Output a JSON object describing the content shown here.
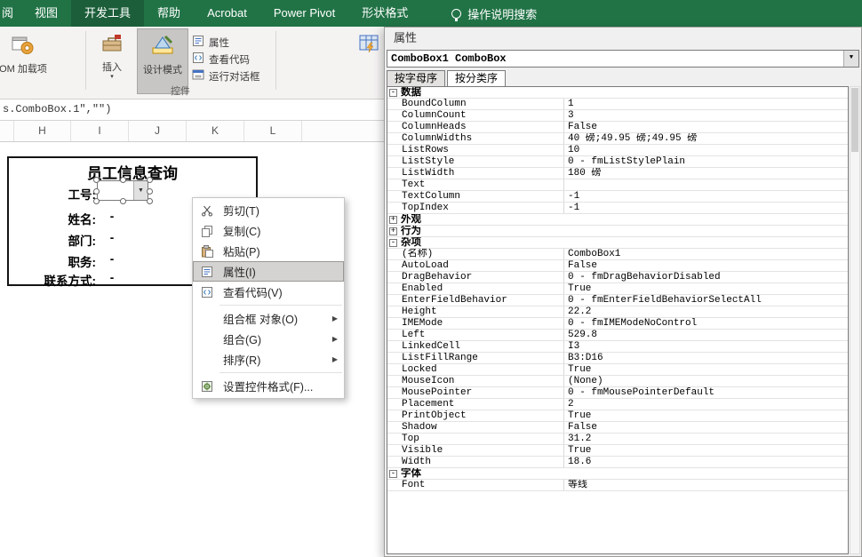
{
  "ribbon": {
    "tabs": [
      {
        "label": "阅",
        "active": false,
        "partial": true
      },
      {
        "label": "视图",
        "active": false
      },
      {
        "label": "开发工具",
        "active": true
      },
      {
        "label": "帮助",
        "active": false
      },
      {
        "label": "Acrobat",
        "active": false
      },
      {
        "label": "Power Pivot",
        "active": false
      },
      {
        "label": "形状格式",
        "active": false
      }
    ],
    "search": {
      "icon": "lightbulb-icon",
      "label": "操作说明搜索"
    },
    "buttons": {
      "com_addins": {
        "label": "OM 加载项",
        "icon": "com-addins-icon"
      },
      "insert": {
        "label": "插入",
        "icon": "toolbox-icon"
      },
      "design_mode": {
        "label": "设计模式",
        "icon": "design-mode-icon",
        "pressed": true
      },
      "properties": {
        "label": "属性",
        "icon": "properties-icon"
      },
      "view_code": {
        "label": "查看代码",
        "icon": "view-code-icon"
      },
      "run_dialog": {
        "label": "运行对话框",
        "icon": "run-dialog-icon"
      },
      "source": {
        "label": "",
        "icon": "source-icon"
      }
    },
    "groups": {
      "controls_label": "控件"
    }
  },
  "formula_bar": {
    "text": "s.ComboBox.1\",\"\")"
  },
  "sheet": {
    "column_headers": [
      "H",
      "I",
      "J",
      "K",
      "L"
    ],
    "form": {
      "title": "员工信息查询",
      "rows": [
        {
          "label": "工号:",
          "value": ""
        },
        {
          "label": "姓名:",
          "value": "-"
        },
        {
          "label": "部门:",
          "value": "-"
        },
        {
          "label": "职务:",
          "value": "-"
        },
        {
          "label": "联系方式:",
          "value": "-"
        }
      ]
    },
    "combobox": {
      "name": "ComboBox1",
      "selected": true
    }
  },
  "context_menu": {
    "items": [
      {
        "label": "剪切(T)",
        "icon": "scissors-icon"
      },
      {
        "label": "复制(C)",
        "icon": "copy-icon"
      },
      {
        "label": "粘贴(P)",
        "icon": "paste-icon"
      },
      {
        "label": "属性(I)",
        "icon": "properties-icon",
        "highlighted": true
      },
      {
        "label": "查看代码(V)",
        "icon": "view-code-icon"
      },
      {
        "separator": true
      },
      {
        "label": "组合框 对象(O)",
        "submenu": true
      },
      {
        "label": "组合(G)",
        "submenu": true
      },
      {
        "label": "排序(R)",
        "submenu": true
      },
      {
        "separator": true
      },
      {
        "label": "设置控件格式(F)...",
        "icon": "format-control-icon"
      }
    ]
  },
  "properties_panel": {
    "title": "属性",
    "object_selector": "ComboBox1 ComboBox",
    "tabs": [
      {
        "label": "按字母序",
        "active": false
      },
      {
        "label": "按分类序",
        "active": true
      }
    ],
    "rows": [
      {
        "type": "category",
        "label": "数据",
        "expanded": true
      },
      {
        "name": "BoundColumn",
        "value": "1"
      },
      {
        "name": "ColumnCount",
        "value": "3"
      },
      {
        "name": "ColumnHeads",
        "value": "False"
      },
      {
        "name": "ColumnWidths",
        "value": "40 磅;49.95 磅;49.95 磅"
      },
      {
        "name": "ListRows",
        "value": "10"
      },
      {
        "name": "ListStyle",
        "value": "0 - fmListStylePlain"
      },
      {
        "name": "ListWidth",
        "value": "180 磅"
      },
      {
        "name": "Text",
        "value": ""
      },
      {
        "name": "TextColumn",
        "value": "-1"
      },
      {
        "name": "TopIndex",
        "value": "-1"
      },
      {
        "type": "category",
        "label": "外观",
        "expanded": false
      },
      {
        "type": "category",
        "label": "行为",
        "expanded": false
      },
      {
        "type": "category",
        "label": "杂项",
        "expanded": true
      },
      {
        "name": "(名称)",
        "value": "ComboBox1"
      },
      {
        "name": "AutoLoad",
        "value": "False"
      },
      {
        "name": "DragBehavior",
        "value": "0 - fmDragBehaviorDisabled"
      },
      {
        "name": "Enabled",
        "value": "True"
      },
      {
        "name": "EnterFieldBehavior",
        "value": "0 - fmEnterFieldBehaviorSelectAll"
      },
      {
        "name": "Height",
        "value": "22.2"
      },
      {
        "name": "IMEMode",
        "value": "0 - fmIMEModeNoControl"
      },
      {
        "name": "Left",
        "value": "529.8"
      },
      {
        "name": "LinkedCell",
        "value": "I3"
      },
      {
        "name": "ListFillRange",
        "value": "B3:D16"
      },
      {
        "name": "Locked",
        "value": "True"
      },
      {
        "name": "MouseIcon",
        "value": "(None)"
      },
      {
        "name": "MousePointer",
        "value": "0 - fmMousePointerDefault"
      },
      {
        "name": "Placement",
        "value": "2"
      },
      {
        "name": "PrintObject",
        "value": "True"
      },
      {
        "name": "Shadow",
        "value": "False"
      },
      {
        "name": "Top",
        "value": "31.2"
      },
      {
        "name": "Visible",
        "value": "True"
      },
      {
        "name": "Width",
        "value": "18.6"
      },
      {
        "type": "category",
        "label": "字体",
        "expanded": true
      },
      {
        "name": "Font",
        "value": "等线"
      }
    ]
  },
  "colors": {
    "ribbon_green": "#217346",
    "pressed_gray": "#c8c6c4",
    "menu_highlight": "#d5d3d1"
  }
}
